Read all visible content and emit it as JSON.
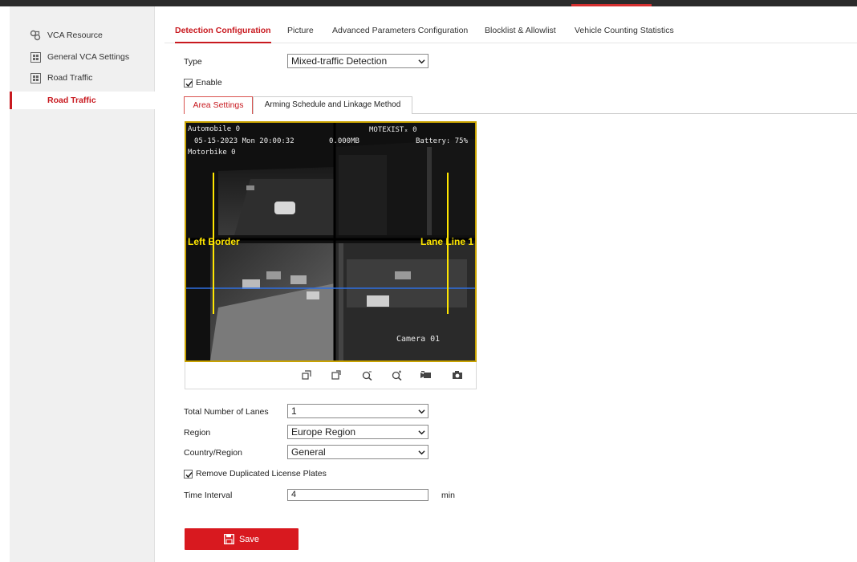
{
  "sidebar": {
    "items": [
      {
        "label": "VCA Resource",
        "icon": "vca-resource-icon"
      },
      {
        "label": "General VCA Settings",
        "icon": "grid-icon"
      },
      {
        "label": "Road Traffic",
        "icon": "grid-icon"
      },
      {
        "label": "Road Traffic",
        "active": true
      }
    ]
  },
  "tabs": [
    {
      "label": "Detection Configuration",
      "active": true
    },
    {
      "label": "Picture"
    },
    {
      "label": "Advanced Parameters Configuration"
    },
    {
      "label": "Blocklist & Allowlist"
    },
    {
      "label": "Vehicle Counting Statistics"
    }
  ],
  "form": {
    "type_label": "Type",
    "type_value": "Mixed-traffic Detection",
    "enable_label": "Enable",
    "enable_checked": true
  },
  "subtabs": {
    "area_settings": "Area Settings",
    "arming": "Arming Schedule and Linkage Method"
  },
  "video": {
    "osd_automobile": "Automobile  0",
    "osd_datetime": "05-15-2023 Mon 20:00:32",
    "osd_size": "0.000MB",
    "osd_motexist": "MOTEXISTₓ 0",
    "osd_battery": "Battery: 75%",
    "osd_motorbike": "Motorbike  0",
    "left_border": "Left Border",
    "lane_line": "Lane Line 1",
    "camera": "Camera 01"
  },
  "video_toolbar": [
    "restore-icon",
    "fit-icon",
    "zoom-out-icon",
    "zoom-in-icon",
    "record-icon",
    "capture-icon"
  ],
  "settings": {
    "lanes_label": "Total Number of Lanes",
    "lanes_value": "1",
    "region_label": "Region",
    "region_value": "Europe Region",
    "country_label": "Country/Region",
    "country_value": "General",
    "dup_label": "Remove Duplicated License Plates",
    "dup_checked": true,
    "interval_label": "Time Interval",
    "interval_value": "4",
    "interval_unit": "min"
  },
  "save_label": "Save",
  "colors": {
    "accent": "#c8191f",
    "overlay_yellow": "#ffe600",
    "detection_line": "#2f6fe0"
  }
}
